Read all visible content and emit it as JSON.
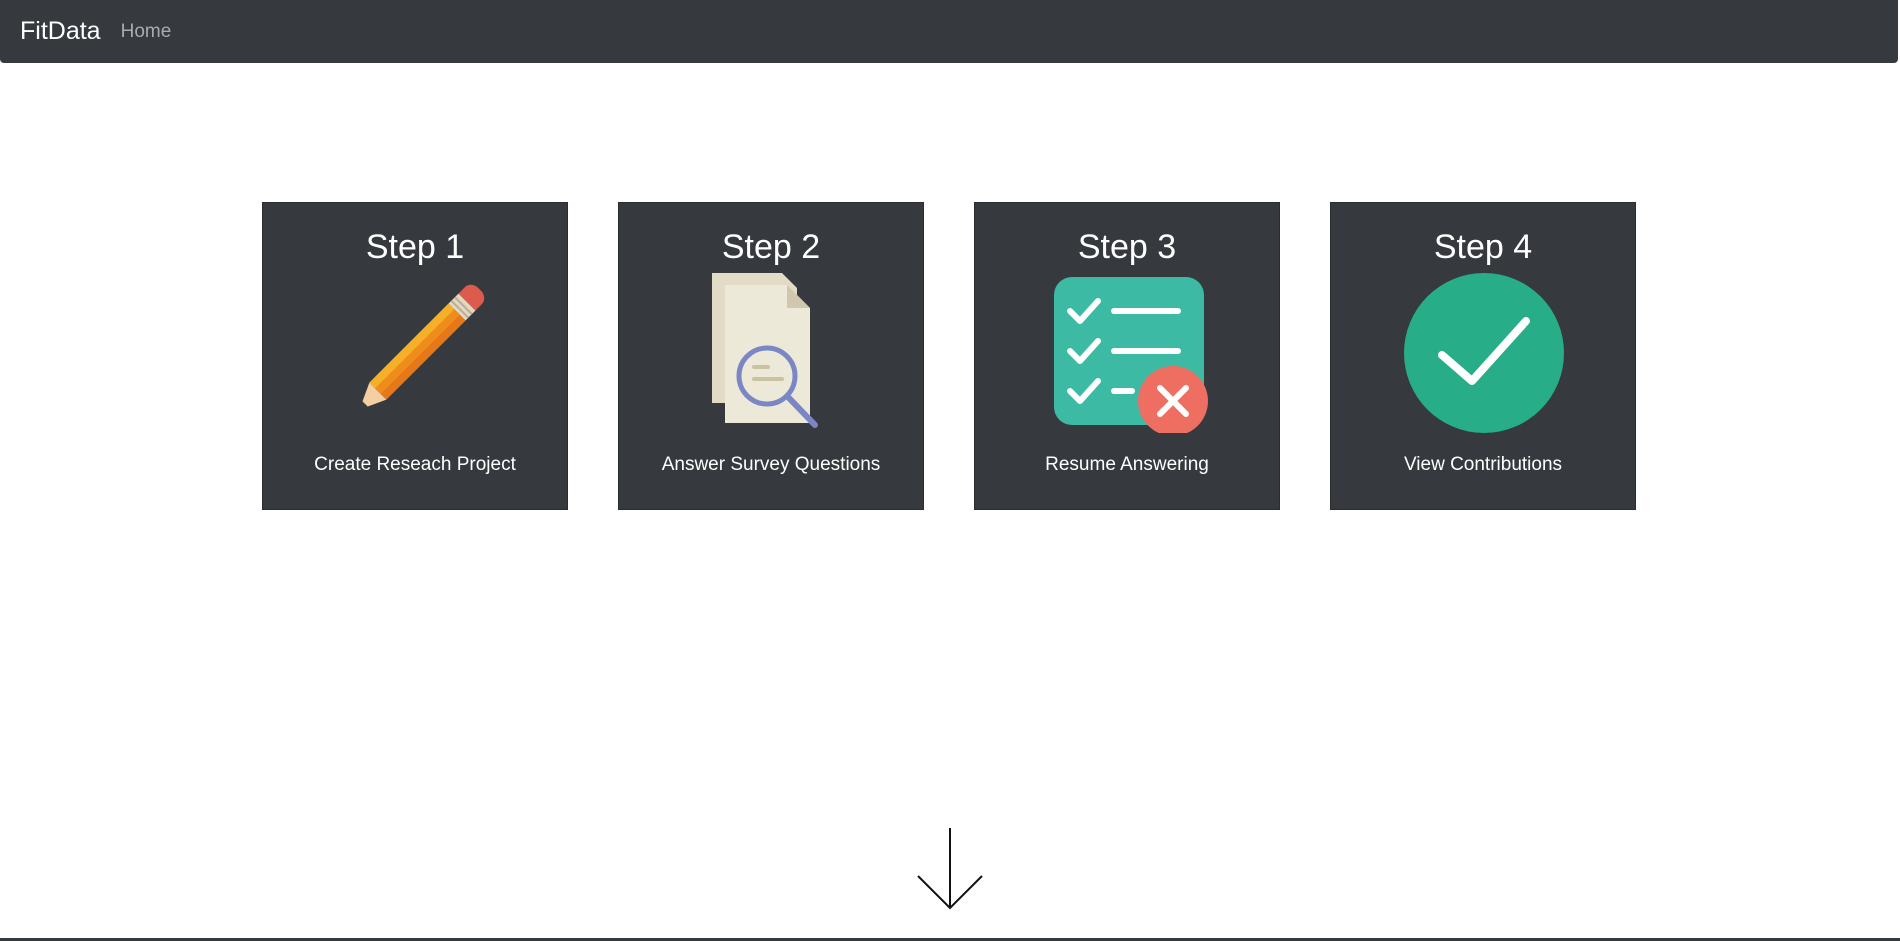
{
  "navbar": {
    "brand": "FitData",
    "links": [
      "Home"
    ]
  },
  "steps": [
    {
      "title": "Step 1",
      "label": "Create Reseach Project",
      "icon": "pencil-icon"
    },
    {
      "title": "Step 2",
      "label": "Answer Survey Questions",
      "icon": "document-search-icon"
    },
    {
      "title": "Step 3",
      "label": "Resume Answering",
      "icon": "checklist-icon"
    },
    {
      "title": "Step 4",
      "label": "View Contributions",
      "icon": "check-circle-icon"
    }
  ],
  "scroll": {
    "icon": "arrow-down-icon"
  },
  "colors": {
    "navbar_bg": "#36393d",
    "card_bg": "#36393d",
    "checklist_teal": "#3dbaa3",
    "check_green": "#27ad88",
    "cross_red": "#ee6f62",
    "pencil_orange": "#ef8d1c",
    "eraser_red": "#dd5b4c"
  }
}
